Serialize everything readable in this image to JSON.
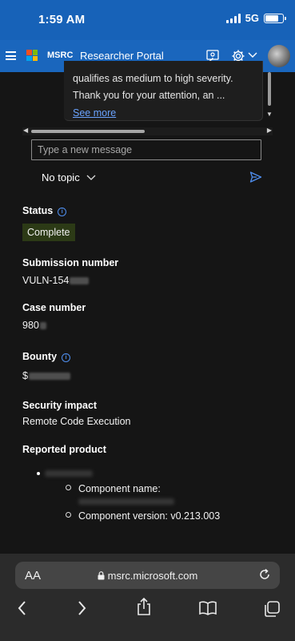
{
  "status_bar": {
    "time": "1:59 AM",
    "network": "5G",
    "battery_level": 0.85
  },
  "header": {
    "brand": "MSRC",
    "title": "Researcher Portal"
  },
  "chat": {
    "line1": "qualifies as medium to high severity.",
    "line2": "Thank you for your attention, an ...",
    "see_more": "See more",
    "input_placeholder": "Type a new message",
    "topic": "No topic"
  },
  "details": {
    "status_label": "Status",
    "status_value": "Complete",
    "submission_label": "Submission number",
    "submission_value": "VULN-154",
    "case_label": "Case number",
    "case_value": "980",
    "bounty_label": "Bounty",
    "bounty_value": "$",
    "impact_label": "Security impact",
    "impact_value": "Remote Code Execution",
    "product_label": "Reported product",
    "component_name": "Component name:",
    "component_version": "Component version: v0.213.003"
  },
  "safari": {
    "aa": "AA",
    "url": "msrc.microsoft.com"
  },
  "colors": {
    "accent": "#1a66bd",
    "link": "#6aa3ff",
    "status_badge_bg": "#2c3a16"
  }
}
